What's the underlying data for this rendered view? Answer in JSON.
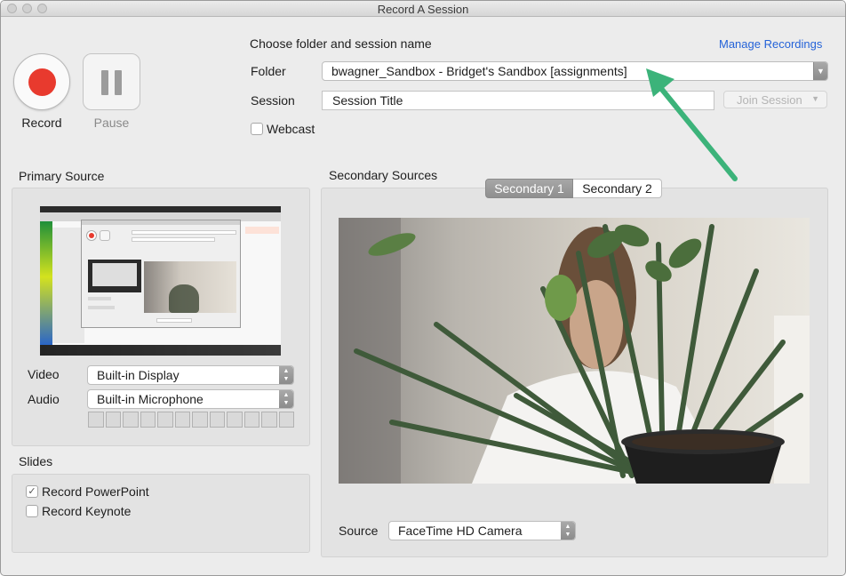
{
  "window": {
    "title": "Record A Session"
  },
  "controls": {
    "record_label": "Record",
    "pause_label": "Pause",
    "record_color": "#e83a2e"
  },
  "session": {
    "heading": "Choose folder and session name",
    "manage_link": "Manage Recordings",
    "folder_label": "Folder",
    "folder_value": "bwagner_Sandbox - Bridget's Sandbox [assignments]",
    "session_label": "Session",
    "session_value": "Session Title",
    "join_label": "Join Session",
    "webcast_label": "Webcast",
    "webcast_checked": false
  },
  "primary": {
    "heading": "Primary Source",
    "video_label": "Video",
    "video_value": "Built-in Display",
    "audio_label": "Audio",
    "audio_value": "Built-in Microphone",
    "meter_levels": [
      0,
      0,
      0,
      0,
      0,
      0,
      0,
      0,
      0,
      0,
      0,
      0
    ]
  },
  "slides": {
    "heading": "Slides",
    "powerpoint_label": "Record PowerPoint",
    "powerpoint_checked": true,
    "keynote_label": "Record Keynote",
    "keynote_checked": false
  },
  "secondary": {
    "heading": "Secondary Sources",
    "tabs": [
      {
        "label": "Secondary 1",
        "selected": true
      },
      {
        "label": "Secondary 2",
        "selected": false
      }
    ],
    "source_label": "Source",
    "source_value": "FaceTime HD Camera"
  },
  "annotation": {
    "arrow_color": "#3cb37a",
    "arrow_icon": "callout-arrow-icon"
  }
}
